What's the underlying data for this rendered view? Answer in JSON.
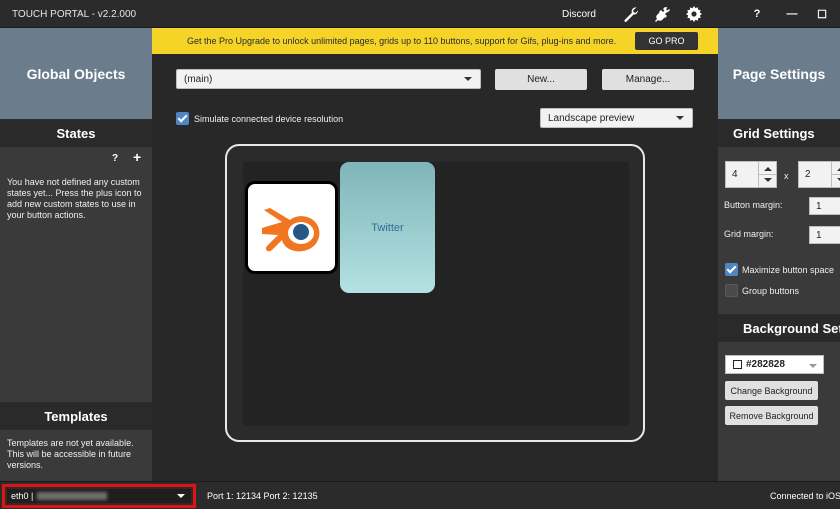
{
  "titlebar": {
    "title": "TOUCH PORTAL - v2.2.000",
    "discord_label": "Discord",
    "icons": [
      "wrench-icon",
      "plug-icon",
      "gear-icon"
    ],
    "help": "?",
    "minimize": "—",
    "maximize": "☐"
  },
  "left": {
    "header": "Global Objects",
    "states": {
      "title": "States",
      "help": "?",
      "add": "+",
      "text": "You have not defined any custom states yet... Press the plus icon to add new custom states to use in your button actions."
    },
    "templates": {
      "title": "Templates",
      "text": "Templates are not yet available. This will be accessible in future versions."
    }
  },
  "banner": {
    "text": "Get the Pro Upgrade to unlock unlimited pages, grids up to 110 buttons, support for Gifs, plug-ins and more.",
    "button": "GO PRO",
    "bg_color": "#f5d327"
  },
  "center": {
    "page_select": "(main)",
    "new_button": "New...",
    "manage_button": "Manage...",
    "simulate_label": "Simulate connected device resolution",
    "simulate_checked": true,
    "preview_select": "Landscape preview",
    "buttons": [
      {
        "name": "blender",
        "label": ""
      },
      {
        "name": "twitter",
        "label": "Twitter"
      }
    ]
  },
  "right": {
    "header": "Page Settings",
    "grid_settings": {
      "title": "Grid Settings",
      "columns": "4",
      "x": "x",
      "rows": "2",
      "button_margin_label": "Button margin:",
      "button_margin": "1",
      "grid_margin_label": "Grid margin:",
      "grid_margin": "1",
      "maximize_label": "Maximize button space",
      "maximize_checked": true,
      "group_label": "Group buttons",
      "group_checked": false
    },
    "background": {
      "title": "Background Settings",
      "color": "#282828",
      "change_button": "Change Background",
      "remove_button": "Remove Background"
    }
  },
  "statusbar": {
    "interface": "eth0 |",
    "ports": "Port 1: 12134 Port 2: 12135",
    "connection": "Connected to iOS"
  }
}
